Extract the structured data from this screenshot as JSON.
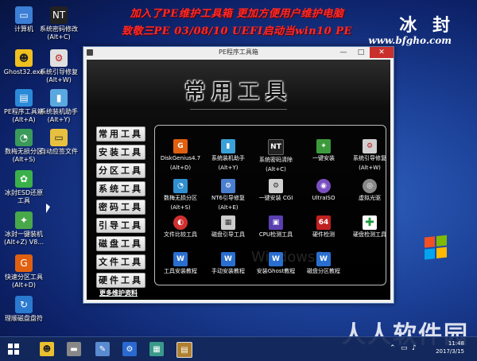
{
  "banner": {
    "line1": "加入了PE维护工具箱  更加方便用户维护电脑",
    "line2": "致敬三PE 03/08/10 UEFI启动当win10 PE"
  },
  "brand": {
    "name": "冰 封",
    "url": "www.bfgho.com"
  },
  "desktop_icons": [
    {
      "label": "计算机",
      "sub": ""
    },
    {
      "label": "系统密码修改",
      "sub": "(Alt+C)"
    },
    {
      "label": "Ghost32.exe",
      "sub": ""
    },
    {
      "label": "系统引导修复",
      "sub": "(Alt+W)"
    },
    {
      "label": "PE程序工具箱",
      "sub": "(Alt+A)"
    },
    {
      "label": "系统装机助手",
      "sub": "(Alt+Y)"
    },
    {
      "label": "数梅无损分区",
      "sub": "(Alt+S)"
    },
    {
      "label": "自动应签文件",
      "sub": ""
    },
    {
      "label": "冰封ESD还原",
      "sub": "工具"
    },
    {
      "label": "冰封一键装机",
      "sub": "(Alt+Z) V8..."
    },
    {
      "label": "快速分区工具",
      "sub": "(Alt+D)"
    },
    {
      "label": "理顺磁盘盘符",
      "sub": ""
    }
  ],
  "window": {
    "title": "PE程序工具箱",
    "minimize": "—",
    "maximize": "□",
    "close": "✕",
    "heading": "常用工具",
    "categories": [
      "常用工具",
      "安装工具",
      "分区工具",
      "系统工具",
      "密码工具",
      "引导工具",
      "磁盘工具",
      "文件工具",
      "硬件工具"
    ],
    "more_link": "更多维护资料",
    "watermark": "Windows8"
  },
  "tools": [
    {
      "label": "DiskGenius4.7",
      "sub": "(Alt+D)",
      "color": "#e06010",
      "glyph": "G"
    },
    {
      "label": "系统装机助手",
      "sub": "(Alt+Y)",
      "color": "#3aa0d8",
      "glyph": "▮"
    },
    {
      "label": "系统密码清除",
      "sub": "(Alt+C)",
      "color": "#222222",
      "glyph": "NT"
    },
    {
      "label": "一键安装",
      "sub": "",
      "color": "#3c9a3c",
      "glyph": "✦"
    },
    {
      "label": "系统引导修复",
      "sub": "(Alt+W)",
      "color": "#d0d0d0",
      "glyph": "⚙"
    },
    {
      "label": "数梅无损分区",
      "sub": "(Alt+S)",
      "color": "#2f8fd0",
      "glyph": "◔"
    },
    {
      "label": "NT6引导修复",
      "sub": "(Alt+E)",
      "color": "#4a7fd0",
      "glyph": "⚙"
    },
    {
      "label": "一键安装 CGI",
      "sub": "",
      "color": "#d0d0d0",
      "glyph": "⚙"
    },
    {
      "label": "UltraISO",
      "sub": "",
      "color": "#7a4fc0",
      "glyph": "◉"
    },
    {
      "label": "虚拟光驱",
      "sub": "",
      "color": "#888888",
      "glyph": "◎"
    },
    {
      "label": "文件比较工具",
      "sub": "",
      "color": "#d03030",
      "glyph": "◐"
    },
    {
      "label": "磁盘引导工具",
      "sub": "",
      "color": "#cccccc",
      "glyph": "▦"
    },
    {
      "label": "CPU检测工具",
      "sub": "",
      "color": "#5a3fb0",
      "glyph": "▣"
    },
    {
      "label": "硬件检测",
      "sub": "",
      "color": "#c02020",
      "glyph": "64"
    },
    {
      "label": "硬盘检测工具",
      "sub": "",
      "color": "#1f9a3a",
      "glyph": "✚"
    },
    {
      "label": "工具安装教程",
      "sub": "",
      "color": "#2a6fd0",
      "glyph": "W"
    },
    {
      "label": "手动安装教程",
      "sub": "",
      "color": "#2a6fd0",
      "glyph": "W"
    },
    {
      "label": "安装Ghost教程",
      "sub": "",
      "color": "#2a6fd0",
      "glyph": "W"
    },
    {
      "label": "磁盘分区教程",
      "sub": "",
      "color": "#2a6fd0",
      "glyph": "W"
    }
  ],
  "taskbar": {
    "time": "11:48",
    "date": "2017/3/15",
    "watermark": "人人软件园"
  }
}
